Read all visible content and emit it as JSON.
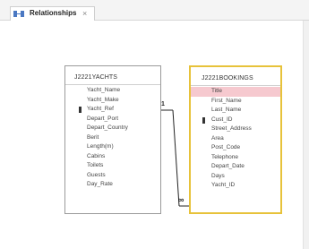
{
  "tab": {
    "label": "Relationships",
    "close_symbol": "×",
    "icon": "relationships-icon"
  },
  "tables": {
    "yachts": {
      "name": "J2221YACHTS",
      "fields": [
        "Yacht_Name",
        "Yacht_Make",
        "Yacht_Ref",
        "Depart_Port",
        "Depart_Country",
        "Berit",
        "Length(m)",
        "Cabins",
        "Toilets",
        "Guests",
        "Day_Rate"
      ],
      "primary_key": "Yacht_Ref"
    },
    "bookings": {
      "name": "J2221BOOKINGS",
      "fields": [
        "Title",
        "First_Name",
        "Last_Name",
        "Cust_ID",
        "Street_Address",
        "Area",
        "Post_Code",
        "Telephone",
        "Depart_Date",
        "Days",
        "Yacht_ID"
      ],
      "primary_key": "Cust_ID",
      "selected_field": "Title"
    }
  },
  "relationship": {
    "one_label": "1",
    "many_label": "∞"
  },
  "colors": {
    "selected_table_border": "#e7c23a",
    "selected_row": "#f6c9cf"
  }
}
